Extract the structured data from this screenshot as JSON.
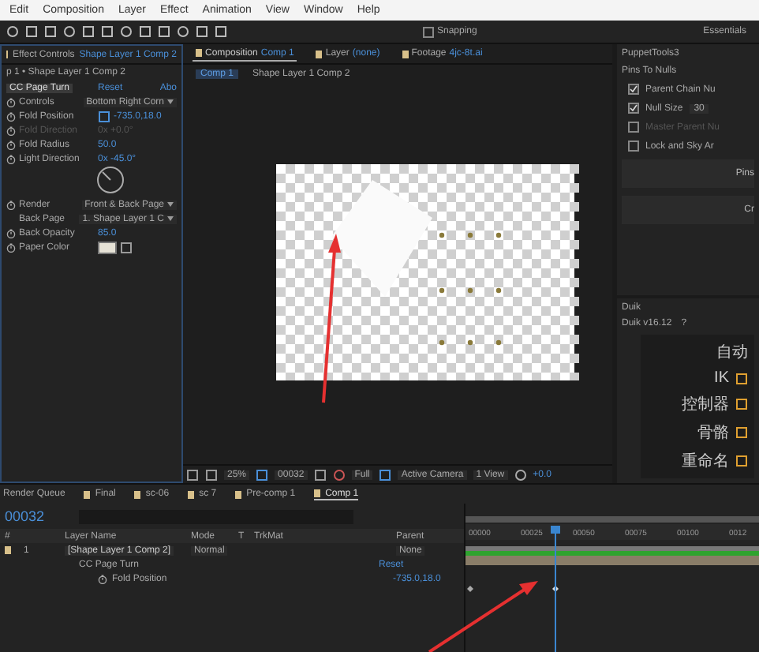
{
  "menu": [
    "Edit",
    "Composition",
    "Layer",
    "Effect",
    "Animation",
    "View",
    "Window",
    "Help"
  ],
  "toolbar": {
    "snapping": {
      "label": "Snapping",
      "checked": false
    },
    "workspace": "Essentials"
  },
  "effect_controls": {
    "tab": "Effect Controls",
    "layer": "Shape Layer 1 Comp 2",
    "breadcrumb": "p 1 • Shape Layer 1 Comp 2",
    "effect": {
      "name": "CC Page Turn",
      "reset": "Reset",
      "about": "Abo"
    },
    "properties": [
      {
        "kind": "dropdown",
        "name": "Controls",
        "value": "Bottom Right Corn",
        "animatable": true,
        "disabled": false
      },
      {
        "kind": "point",
        "name": "Fold Position",
        "value": "-735.0,18.0",
        "animatable": true,
        "disabled": false
      },
      {
        "kind": "value",
        "name": "Fold Direction",
        "value": "0x +0.0°",
        "animatable": true,
        "disabled": true
      },
      {
        "kind": "value",
        "name": "Fold Radius",
        "value": "50.0",
        "animatable": true,
        "disabled": false
      },
      {
        "kind": "value",
        "name": "Light Direction",
        "value": "0x -45.0°",
        "animatable": true,
        "disabled": false
      },
      {
        "kind": "dial"
      },
      {
        "kind": "dropdown",
        "name": "Render",
        "value": "Front & Back Page",
        "animatable": true,
        "disabled": false
      },
      {
        "kind": "dropdown",
        "name": "Back Page",
        "value": "1. Shape Layer 1 C",
        "animatable": false,
        "disabled": false
      },
      {
        "kind": "value",
        "name": "Back Opacity",
        "value": "85.0",
        "animatable": true,
        "disabled": false
      },
      {
        "kind": "color",
        "name": "Paper Color",
        "color": "#e6e2d6",
        "animatable": true,
        "disabled": false
      }
    ]
  },
  "composition": {
    "tabs": [
      {
        "label": "Composition",
        "name": "Comp 1",
        "selected": true
      },
      {
        "label": "Layer",
        "name": "(none)",
        "selected": false
      },
      {
        "label": "Footage",
        "name": "4jc-8t.ai",
        "selected": false
      }
    ],
    "breadcrumb": [
      {
        "label": "Comp 1",
        "selected": true
      },
      {
        "label": "Shape Layer 1 Comp 2",
        "selected": false
      }
    ],
    "viewer_toolbar": {
      "zoom": "25%",
      "time": "00032",
      "resolution": "Full",
      "camera": "Active Camera",
      "views": "1 View",
      "exposure": "+0.0"
    }
  },
  "puppet_tools": {
    "title": "PuppetTools3",
    "section": "Pins To Nulls",
    "options": [
      {
        "label": "Parent Chain Nu",
        "checked": true,
        "disabled": false
      },
      {
        "label": "Null Size",
        "checked": true,
        "disabled": false,
        "value": "30"
      },
      {
        "label": "Master Parent Nu",
        "checked": false,
        "disabled": true
      },
      {
        "label": "Lock and Sky Ar",
        "checked": false,
        "disabled": false
      }
    ],
    "buttons": [
      "Pins",
      "Cr"
    ]
  },
  "duik": {
    "title": "Duik",
    "version": "Duik v16.12",
    "help": "?",
    "heading": "自动",
    "rows": [
      {
        "label": "IK"
      },
      {
        "label": "控制器"
      },
      {
        "label": "骨骼"
      },
      {
        "label": "重命名"
      }
    ]
  },
  "timeline": {
    "tabs": [
      {
        "label": "Render Queue",
        "selected": false
      },
      {
        "label": "Final",
        "selected": false
      },
      {
        "label": "sc-06",
        "selected": false
      },
      {
        "label": "sc 7",
        "selected": false
      },
      {
        "label": "Pre-comp 1",
        "selected": false
      },
      {
        "label": "Comp 1",
        "selected": true
      }
    ],
    "timecode": "00032",
    "columns": [
      "#",
      "Layer Name",
      "Mode",
      "T",
      "TrkMat",
      "Parent"
    ],
    "layer": {
      "number": "1",
      "name": "[Shape Layer 1 Comp 2]",
      "mode": "Normal",
      "parent": "None"
    },
    "effect": {
      "name": "CC Page Turn",
      "value": "Reset"
    },
    "property": {
      "name": "Fold Position",
      "value": "-735.0,18.0"
    },
    "ruler": [
      "00000",
      "00025",
      "00050",
      "00075",
      "00100",
      "0012"
    ]
  }
}
